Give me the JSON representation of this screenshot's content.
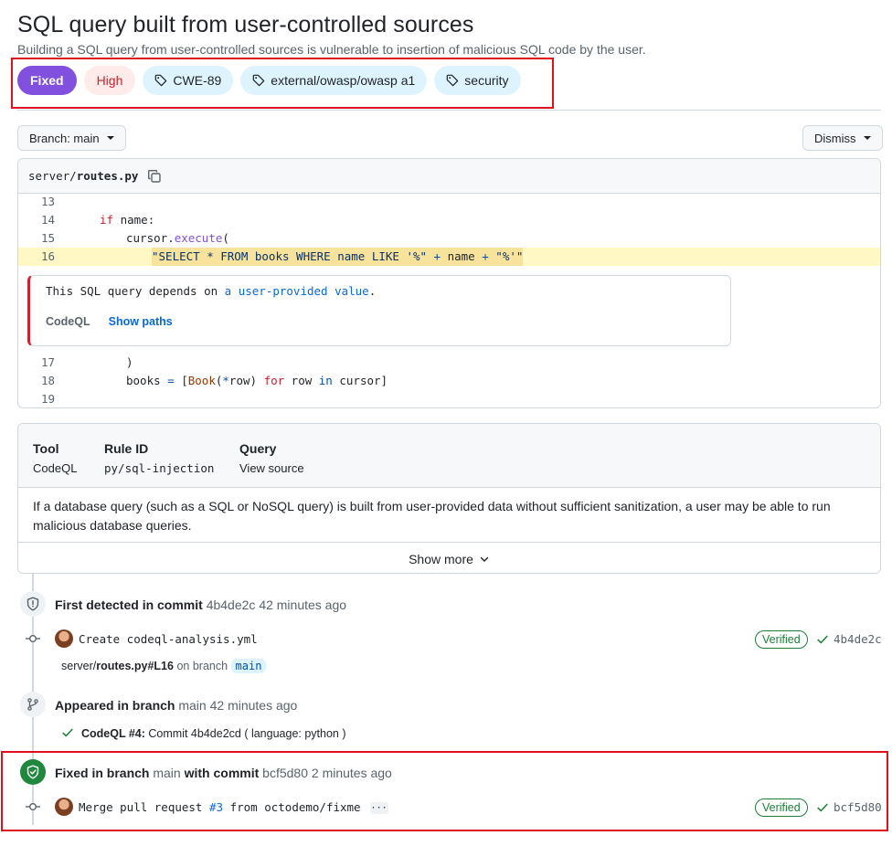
{
  "header": {
    "title": "SQL query built from user-controlled sources",
    "subtitle": "Building a SQL query from user-controlled sources is vulnerable to insertion of malicious SQL code by the user."
  },
  "labels": {
    "status": "Fixed",
    "severity": "High",
    "tags": [
      "CWE-89",
      "external/owasp/owasp a1",
      "security"
    ]
  },
  "toolbar": {
    "branch_label": "Branch: main",
    "dismiss_label": "Dismiss"
  },
  "code": {
    "path_prefix": "server/",
    "file_name": "routes.py",
    "lines": [
      {
        "num": "13"
      },
      {
        "num": "14"
      },
      {
        "num": "15"
      },
      {
        "num": "16"
      },
      {
        "num": "17"
      },
      {
        "num": "18"
      },
      {
        "num": "19"
      }
    ],
    "line14_kw": "if",
    "line14_rest": " name:",
    "line15_obj": "cursor.",
    "line15_fn": "execute",
    "line15_paren": "(",
    "line16_s1": "\"SELECT * FROM books WHERE name LIKE '%\"",
    "line16_plus1": " + ",
    "line16_name": "name",
    "line16_plus2": " + ",
    "line16_s2": "\"%'\"",
    "line17": ")",
    "line18_a": "books ",
    "line18_eq": "=",
    "line18_b": " [",
    "line18_book": "Book",
    "line18_c": "(",
    "line18_star": "*",
    "line18_d": "row) ",
    "line18_for": "for",
    "line18_e": " row ",
    "line18_in": "in",
    "line18_f": " cursor]",
    "alert_text_pre": "This SQL query depends on ",
    "alert_link": "a user-provided value",
    "alert_text_post": ".",
    "alert_tool": "CodeQL",
    "alert_show_paths": "Show paths"
  },
  "info": {
    "tool_header": "Tool",
    "tool_value": "CodeQL",
    "rule_header": "Rule ID",
    "rule_value": "py/sql-injection",
    "query_header": "Query",
    "query_value": "View source",
    "description": "If a database query (such as a SQL or NoSQL query) is built from user-provided data without sufficient sanitization, a user may be able to run malicious database queries.",
    "show_more": "Show more"
  },
  "timeline": {
    "first_detected_label": "First detected in commit",
    "first_detected_sha": "4b4de2c",
    "first_detected_time": "42 minutes ago",
    "commit1_msg": "Create codeql-analysis.yml",
    "commit1_verified": "Verified",
    "commit1_sha": "4b4de2c",
    "commit1_path_prefix": "server/",
    "commit1_path_file": "routes.py#L16",
    "commit1_on_branch": "on branch",
    "commit1_branch": "main",
    "appeared_label": "Appeared in branch",
    "appeared_branch": "main",
    "appeared_time": "42 minutes ago",
    "run_name": "CodeQL #4:",
    "run_detail": "Commit 4b4de2cd ( language: python )",
    "fixed_label": "Fixed in branch",
    "fixed_branch": "main",
    "fixed_with": "with commit",
    "fixed_sha": "bcf5d80",
    "fixed_time": "2 minutes ago",
    "commit2_msg_pre": "Merge pull request ",
    "commit2_pr": "#3",
    "commit2_msg_post": " from octodemo/fixme",
    "commit2_ellipsis": "···",
    "commit2_verified": "Verified",
    "commit2_sha": "bcf5d80"
  },
  "colors": {
    "accent_purple": "#8250df",
    "danger_red": "#cf222e",
    "success_green": "#1f883d",
    "link_blue": "#0969da",
    "annotation_red": "#e0111d"
  }
}
